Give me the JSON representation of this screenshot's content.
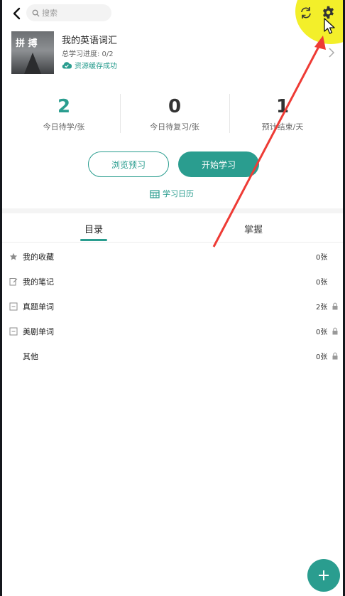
{
  "header": {
    "search_placeholder": "搜索"
  },
  "book": {
    "cover_title": "拼 搏",
    "title": "我的英语词汇",
    "progress": "总学习进度: 0/2",
    "cache_status": "资源缓存成功"
  },
  "stats": [
    {
      "value": "2",
      "label": "今日待学/张",
      "color": "#2a9d8f"
    },
    {
      "value": "0",
      "label": "今日待复习/张",
      "color": "#333333"
    },
    {
      "value": "1",
      "label": "预计结束/天",
      "color": "#333333"
    }
  ],
  "actions": {
    "browse_label": "浏览预习",
    "start_label": "开始学习",
    "calendar_label": "学习日历"
  },
  "tabs": [
    {
      "label": "目录",
      "active": true
    },
    {
      "label": "掌握",
      "active": false
    }
  ],
  "catalog": [
    {
      "name": "我的收藏",
      "count": "0张",
      "icon": "star-icon",
      "locked": false
    },
    {
      "name": "我的笔记",
      "count": "0张",
      "icon": "note-icon",
      "locked": false
    },
    {
      "name": "真题单词",
      "count": "2张",
      "icon": "collapse-icon",
      "locked": true
    },
    {
      "name": "美剧单词",
      "count": "0张",
      "icon": "collapse-icon",
      "locked": true
    },
    {
      "name": "其他",
      "count": "0张",
      "icon": "",
      "locked": true
    }
  ],
  "colors": {
    "accent": "#2a9d8f",
    "highlight": "#f3ef2a",
    "annotation_arrow": "#ee3b35"
  }
}
